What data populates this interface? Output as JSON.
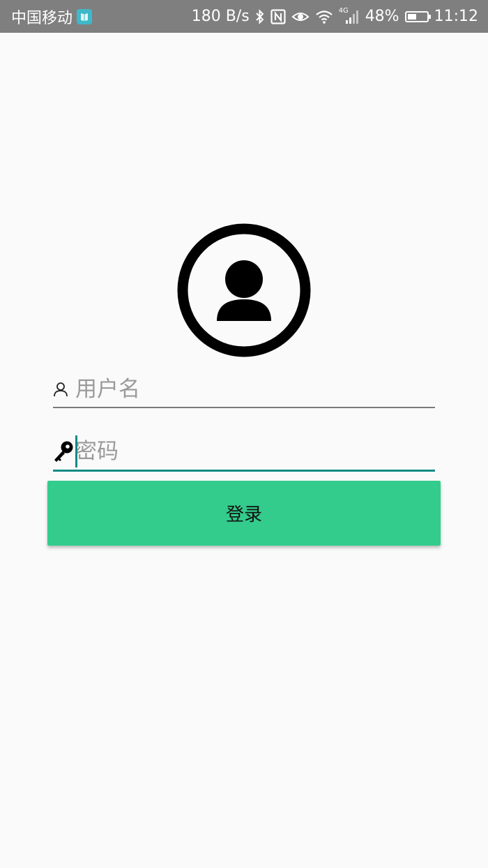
{
  "status_bar": {
    "carrier": "中国移动",
    "network_speed": "180 B/s",
    "network_type": "4G",
    "battery_percent": "48%",
    "battery_level": 0.48,
    "time": "11:12"
  },
  "login": {
    "username_placeholder": "用户名",
    "password_placeholder": "密码",
    "login_label": "登录"
  },
  "colors": {
    "status_bar": "#7f7f7f",
    "accent": "#138a86",
    "button": "#33cc8c",
    "background": "#fafafa"
  },
  "icons": {
    "avatar": "user-circle-icon",
    "username": "person-outline-icon",
    "password": "key-icon"
  }
}
